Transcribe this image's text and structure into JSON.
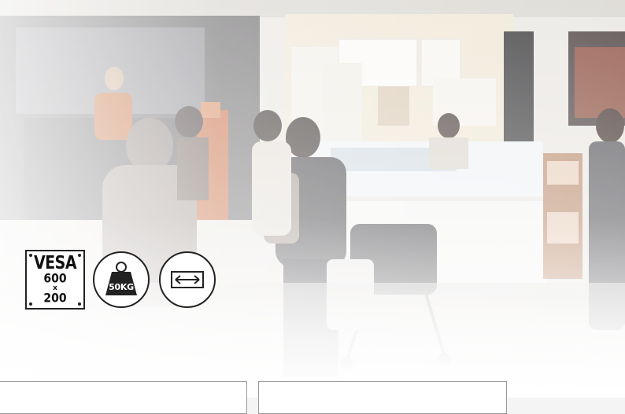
{
  "background": {
    "description_colors": {
      "accent": "#222222",
      "panel_border": "#9a9a9a"
    }
  },
  "spec_icons": {
    "vesa": {
      "title": "VESA",
      "width": "600",
      "times": "x",
      "height": "200"
    },
    "weight": {
      "label": "50KG",
      "icon": "weight-icon"
    },
    "mount": {
      "icon": "double-arrow-icon"
    }
  },
  "panels": [
    {
      "name": "info-panel-left"
    },
    {
      "name": "info-panel-right"
    }
  ]
}
